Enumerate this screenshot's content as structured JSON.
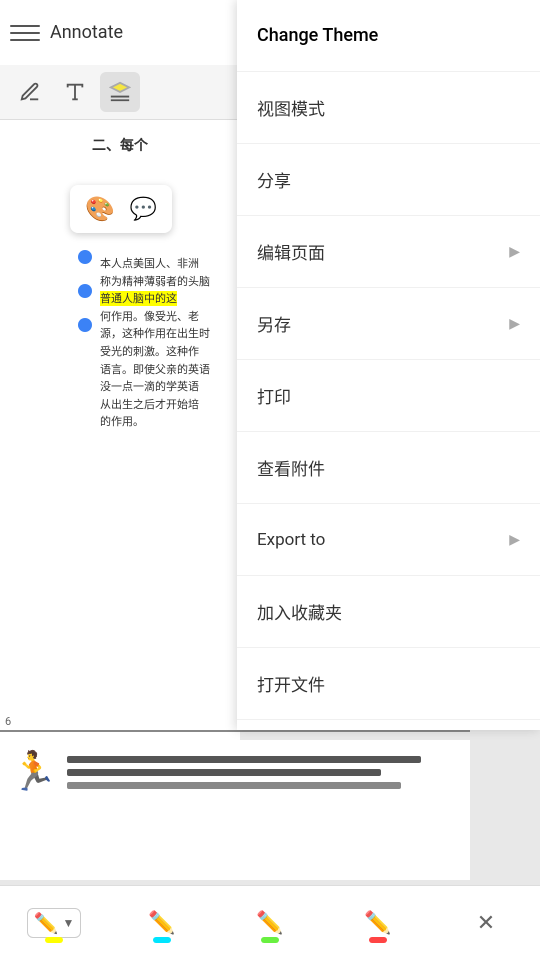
{
  "app": {
    "title": "Annotate"
  },
  "toolbar": {
    "menu_icon": "☰",
    "tools": [
      {
        "name": "pen",
        "icon": "✏️",
        "active": false
      },
      {
        "name": "text",
        "icon": "A",
        "active": false
      },
      {
        "name": "highlight",
        "icon": "🖊",
        "active": true
      }
    ]
  },
  "dropdown": {
    "items": [
      {
        "id": "change-theme",
        "label": "Change Theme",
        "has_arrow": false
      },
      {
        "id": "view-mode",
        "label": "视图模式",
        "has_arrow": false
      },
      {
        "id": "share",
        "label": "分享",
        "has_arrow": false
      },
      {
        "id": "edit-page",
        "label": "编辑页面",
        "has_arrow": true
      },
      {
        "id": "save-as",
        "label": "另存",
        "has_arrow": true
      },
      {
        "id": "print",
        "label": "打印",
        "has_arrow": false
      },
      {
        "id": "view-attachments",
        "label": "查看附件",
        "has_arrow": false
      },
      {
        "id": "export-to",
        "label": "Export to",
        "has_arrow": true
      },
      {
        "id": "add-to-favorites",
        "label": "加入收藏夹",
        "has_arrow": false
      },
      {
        "id": "open-file",
        "label": "打开文件",
        "has_arrow": false
      }
    ]
  },
  "doc": {
    "heading": "二、每个",
    "body_text": "本人点美国人、非洲\n称为精神薄弱者的头脑\n普通人脑中的这\n何作用。像受光、老\n源，这种作用在出生时\n受光的刺激。这种作\n语言。即使父亲的英语\n没一点一滴的学英语的\n从出生之后才开始培\n的作用。",
    "highlight_text": "普通人脑中的这",
    "page_number": "6"
  },
  "bottom_toolbar": {
    "tools": [
      {
        "name": "highlight-yellow",
        "color": "#ffff00",
        "active": true
      },
      {
        "name": "highlight-cyan",
        "color": "#00e5ff"
      },
      {
        "name": "highlight-green",
        "color": "#69f040"
      },
      {
        "name": "highlight-red",
        "color": "#ff4444"
      }
    ],
    "close_label": "✕"
  }
}
